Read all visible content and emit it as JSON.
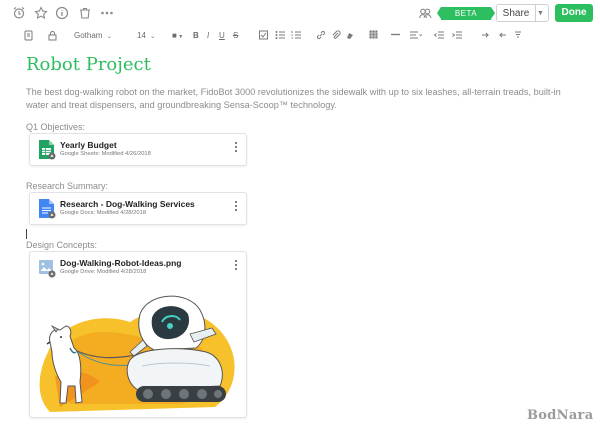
{
  "toolbar": {
    "icons": [
      "alarm-clock-icon",
      "star-icon",
      "info-icon",
      "trash-icon",
      "more-icon",
      "workchat-icon"
    ],
    "beta_label": "BETA",
    "share_label": "Share",
    "done_label": "Done"
  },
  "format_bar": {
    "font_family": "Gotham",
    "font_size": "14",
    "buttons": [
      "attach-icon",
      "lock-icon",
      "text-color-icon",
      "bold-icon",
      "italic-icon",
      "underline-icon",
      "strikethrough-icon",
      "checkbox-icon",
      "bullet-list-icon",
      "numbered-list-icon",
      "link-icon",
      "attachment-icon",
      "highlight-icon",
      "table-icon",
      "align-icon",
      "outdent-icon",
      "indent-icon",
      "undo-icon",
      "redo-icon",
      "eraser-icon"
    ]
  },
  "note": {
    "title": "Robot Project",
    "description": "The best dog-walking robot on the market, FidoBot 3000 revolutionizes the sidewalk with up to six leashes, all-terrain treads, built-in water and treat dispensers, and groundbreaking Sensa-Scoop™ technology.",
    "sections": [
      {
        "label": "Q1 Objectives:",
        "file": {
          "name": "Yearly Budget",
          "meta": "Google Sheets: Modified 4/26/2018",
          "type": "sheets",
          "color": "#1fa463"
        }
      },
      {
        "label": "Research Summary:",
        "file": {
          "name": "Research - Dog-Walking Services",
          "meta": "Google Docs: Modified 4/28/2018",
          "type": "docs",
          "color": "#4285f4"
        }
      },
      {
        "label": "Design Concepts:",
        "file": {
          "name": "Dog-Walking-Robot-Ideas.png",
          "meta": "Google Drive: Modified 4/28/2018",
          "type": "drive-image",
          "color": "#5b9bd5"
        }
      }
    ]
  },
  "watermark": "BodNara"
}
